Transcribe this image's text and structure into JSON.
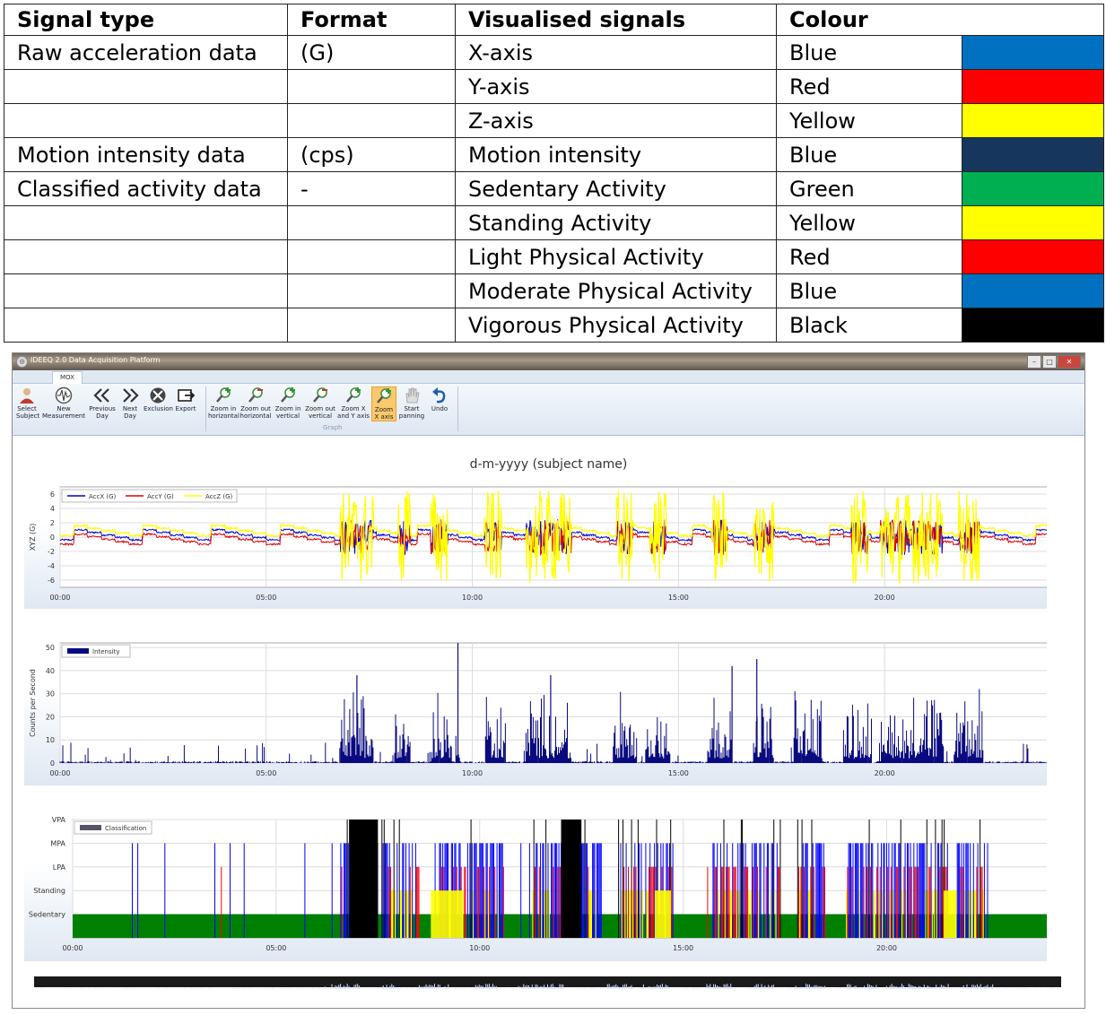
{
  "legend_table": {
    "headers": [
      "Signal type",
      "Format",
      "Visualised signals",
      "Colour"
    ],
    "rows": [
      {
        "signal_type": "Raw acceleration data",
        "format": "(G)",
        "signal": "X-axis",
        "colour": "Blue",
        "swatch": "#0070c0"
      },
      {
        "signal_type": "",
        "format": "",
        "signal": "Y-axis",
        "colour": "Red",
        "swatch": "#ff0000"
      },
      {
        "signal_type": "",
        "format": "",
        "signal": "Z-axis",
        "colour": "Yellow",
        "swatch": "#ffff00"
      },
      {
        "signal_type": "Motion intensity data",
        "format": "(cps)",
        "signal": "Motion intensity",
        "colour": "Blue",
        "swatch": "#17365d"
      },
      {
        "signal_type": "Classified activity data",
        "format": "-",
        "signal": "Sedentary Activity",
        "colour": "Green",
        "swatch": "#00b050"
      },
      {
        "signal_type": "",
        "format": "",
        "signal": "Standing Activity",
        "colour": "Yellow",
        "swatch": "#ffff00"
      },
      {
        "signal_type": "",
        "format": "",
        "signal": "Light Physical Activity",
        "colour": "Red",
        "swatch": "#ff0000"
      },
      {
        "signal_type": "",
        "format": "",
        "signal": "Moderate Physical Activity",
        "colour": "Blue",
        "swatch": "#0070c0"
      },
      {
        "signal_type": "",
        "format": "",
        "signal": "Vigorous Physical Activity",
        "colour": "Black",
        "swatch": "#000000"
      }
    ]
  },
  "window": {
    "title": "IDEEQ 2.0 Data Acquisition Platform",
    "tab": "MOX",
    "buttons": [
      {
        "label1": "Select",
        "label2": "Subject",
        "icon": "person-icon"
      },
      {
        "label1": "New",
        "label2": "Measurement",
        "icon": "waveform-icon"
      },
      {
        "label1": "Previous",
        "label2": "Day",
        "icon": "double-chevron-left-icon"
      },
      {
        "label1": "Next",
        "label2": "Day",
        "icon": "double-chevron-right-icon"
      },
      {
        "label1": "Exclusion",
        "label2": "",
        "icon": "exclusion-icon"
      },
      {
        "label1": "Export",
        "label2": "",
        "icon": "export-icon"
      },
      {
        "label1": "Zoom in",
        "label2": "horizontal",
        "icon": "zoom-in-horizontal-icon"
      },
      {
        "label1": "Zoom out",
        "label2": "horizontal",
        "icon": "zoom-out-horizontal-icon"
      },
      {
        "label1": "Zoom in",
        "label2": "vertical",
        "icon": "zoom-in-vertical-icon"
      },
      {
        "label1": "Zoom out",
        "label2": "vertical",
        "icon": "zoom-out-vertical-icon"
      },
      {
        "label1": "Zoom X",
        "label2": "and Y axis",
        "icon": "zoom-xy-icon"
      },
      {
        "label1": "Zoom",
        "label2": "X axis",
        "icon": "zoom-x-icon",
        "active": true
      },
      {
        "label1": "Start",
        "label2": "panning",
        "icon": "hand-icon"
      },
      {
        "label1": "Undo",
        "label2": "",
        "icon": "undo-icon"
      }
    ],
    "group_label": "Graph",
    "chart_title": "d-m-yyyy (subject name)"
  },
  "chart_data": [
    {
      "type": "line",
      "id": "acceleration",
      "ylabel": "XYZ (G)",
      "ylim": [
        -7,
        7
      ],
      "yticks": [
        6,
        4,
        2,
        0,
        -2,
        -4,
        -6
      ],
      "xlim": [
        0,
        24
      ],
      "xticks": [
        "00:00",
        "05:00",
        "10:00",
        "15:00",
        "20:00"
      ],
      "legend": "top-left",
      "series": [
        {
          "name": "AccX (G)",
          "color": "#0000cc"
        },
        {
          "name": "AccY (G)",
          "color": "#dd0000"
        },
        {
          "name": "AccZ (G)",
          "color": "#ffff00"
        }
      ],
      "active_segments": [
        [
          6.8,
          7.6
        ],
        [
          8.2,
          8.5
        ],
        [
          9.0,
          9.4
        ],
        [
          10.3,
          10.7
        ],
        [
          11.3,
          12.4
        ],
        [
          13.5,
          13.9
        ],
        [
          14.3,
          14.7
        ],
        [
          15.8,
          16.2
        ],
        [
          16.8,
          17.3
        ],
        [
          19.2,
          19.6
        ],
        [
          19.9,
          21.4
        ],
        [
          21.8,
          22.3
        ]
      ]
    },
    {
      "type": "bar",
      "id": "intensity",
      "ylabel": "Counts per Second",
      "ylim": [
        0,
        52
      ],
      "yticks": [
        50,
        40,
        30,
        20,
        10,
        0
      ],
      "xlim": [
        0,
        24
      ],
      "xticks": [
        "00:00",
        "05:00",
        "10:00",
        "15:00",
        "20:00"
      ],
      "legend": "top-left",
      "series": [
        {
          "name": "Intensity",
          "color": "#0a0a80"
        }
      ],
      "active_segments": [
        [
          6.8,
          7.6
        ],
        [
          8.1,
          8.5
        ],
        [
          9.0,
          9.5
        ],
        [
          9.6,
          9.7
        ],
        [
          10.3,
          10.8
        ],
        [
          11.3,
          12.4
        ],
        [
          13.4,
          14.0
        ],
        [
          14.2,
          14.8
        ],
        [
          15.7,
          16.3
        ],
        [
          16.8,
          17.3
        ],
        [
          17.8,
          18.5
        ],
        [
          19.0,
          19.7
        ],
        [
          19.9,
          21.4
        ],
        [
          21.7,
          22.4
        ]
      ],
      "peaks": [
        {
          "x": 9.65,
          "y": 52
        },
        {
          "x": 7.2,
          "y": 38
        },
        {
          "x": 16.9,
          "y": 45
        },
        {
          "x": 16.3,
          "y": 42
        },
        {
          "x": 11.9,
          "y": 38
        }
      ]
    },
    {
      "type": "bar",
      "id": "classification",
      "ylabels": [
        "VPA",
        "MPA",
        "LPA",
        "Standing",
        "Sedentary"
      ],
      "xlim": [
        0,
        24
      ],
      "xticks": [
        "00:00",
        "05:00",
        "10:00",
        "15:00",
        "20:00"
      ],
      "legend": "top-left",
      "series": [
        {
          "name": "Classification",
          "color": "#555566"
        }
      ],
      "level_colors": {
        "Sedentary": "#008000",
        "Standing": "#ffff00",
        "LPA": "#ff0000",
        "MPA": "#0000ff",
        "VPA": "#000000"
      },
      "vpa_blocks": [
        [
          6.8,
          7.5
        ],
        [
          12.0,
          12.5
        ]
      ],
      "standing_blocks": [
        [
          8.8,
          9.6
        ],
        [
          14.3,
          14.7
        ],
        [
          21.4,
          21.7
        ]
      ],
      "active_segments": [
        [
          6.6,
          8.5
        ],
        [
          9.0,
          10.6
        ],
        [
          11.3,
          13.0
        ],
        [
          13.4,
          14.8
        ],
        [
          15.7,
          17.4
        ],
        [
          17.8,
          18.5
        ],
        [
          19.0,
          21.5
        ],
        [
          21.7,
          22.4
        ]
      ]
    }
  ]
}
